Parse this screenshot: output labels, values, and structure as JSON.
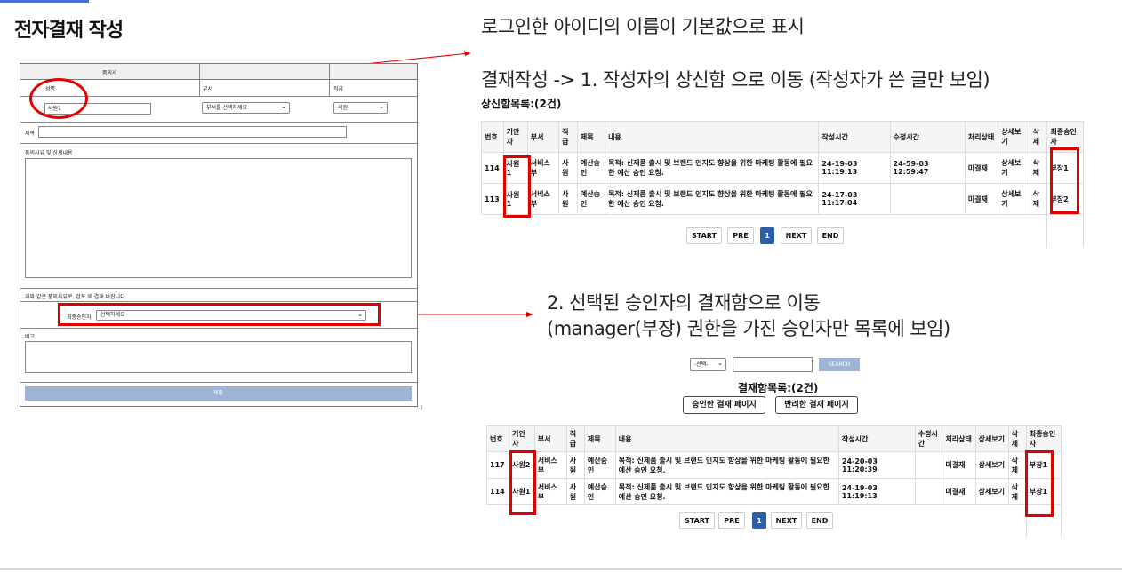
{
  "page": {
    "title": "전자결재 작성",
    "annotations": {
      "default_name": "로그인한 아이디의 이름이 기본값으로 표시",
      "draft_flow": "결재작성 -> 1. 작성자의 상신함 으로 이동 (작성자가 쓴 글만 보임)",
      "approver_flow_1": "2. 선택된 승인자의 결재함으로 이동",
      "approver_flow_2": "(manager(부장) 권한을 가진 승인자만 목록에 보임)"
    }
  },
  "form": {
    "header": "품의서",
    "name_label": "성명",
    "dept_label": "부서",
    "rank_label": "직급",
    "name_value": "사원1",
    "dept_select": "부서를 선택하세요",
    "rank_select": "사원",
    "subject_label": "제목",
    "reason_label": "품의사유 및 상세내용",
    "notice": "위와 같은 품의사유로, 검토 후 결재 바랍니다.",
    "approver_label": "최종승인자",
    "approver_select": "선택하세요",
    "memo_label": "비고",
    "submit_label": "제출"
  },
  "sent": {
    "title": "상신함목록:(2건)",
    "headers": [
      "번호",
      "기안자",
      "부서",
      "직급",
      "제목",
      "내용",
      "작성시간",
      "수정시간",
      "처리상태",
      "상세보기",
      "삭제",
      "최종승인자"
    ],
    "rows": [
      [
        "114",
        "사원1",
        "서비스부",
        "사원",
        "예산승인",
        "목적: 신제품 출시 및 브랜드 인지도 향상을 위한 마케팅 활동에 필요한 예산 승인 요청.",
        "24-19-03 11:19:13",
        "24-59-03 12:59:47",
        "미결재",
        "상세보기",
        "삭제",
        "부장1"
      ],
      [
        "113",
        "사원1",
        "서비스부",
        "사원",
        "예산승인",
        "목적: 신제품 출시 및 브랜드 인지도 향상을 위한 마케팅 활동에 필요한 예산 승인 요청.",
        "24-17-03 11:17:04",
        "",
        "미결재",
        "상세보기",
        "삭제",
        "부장2"
      ]
    ],
    "pager": [
      "START",
      "PRE",
      "1",
      "NEXT",
      "END"
    ]
  },
  "inbox": {
    "search_select": "-선택-",
    "search_button": "SEARCH",
    "title": "결재함목록:(2건)",
    "approved_button": "승인한 결재 페이지",
    "rejected_button": "반려한 결재 페이지",
    "headers": [
      "번호",
      "기안자",
      "부서",
      "직급",
      "제목",
      "내용",
      "작성시간",
      "수정시간",
      "처리상태",
      "상세보기",
      "삭제",
      "최종승인자"
    ],
    "rows": [
      [
        "117",
        "사원2",
        "서비스부",
        "사원",
        "예산승인",
        "목적: 신제품 출시 및 브랜드 인지도 향상을 위한 마케팅 활동에 필요한 예산 승인 요청.",
        "24-20-03 11:20:39",
        "",
        "미결재",
        "상세보기",
        "삭제",
        "부장1"
      ],
      [
        "114",
        "사원1",
        "서비스부",
        "사원",
        "예산승인",
        "목적: 신제품 출시 및 브랜드 인지도 향상을 위한 마케팅 활동에 필요한 예산 승인 요청.",
        "24-19-03 11:19:13",
        "",
        "미결재",
        "상세보기",
        "삭제",
        "부장1"
      ]
    ],
    "pager": [
      "START",
      "PRE",
      "1",
      "NEXT",
      "END"
    ]
  },
  "colors": {
    "highlight": "#e00000",
    "pager_active": "#2c5fa8",
    "submit": "#9db4d6"
  }
}
